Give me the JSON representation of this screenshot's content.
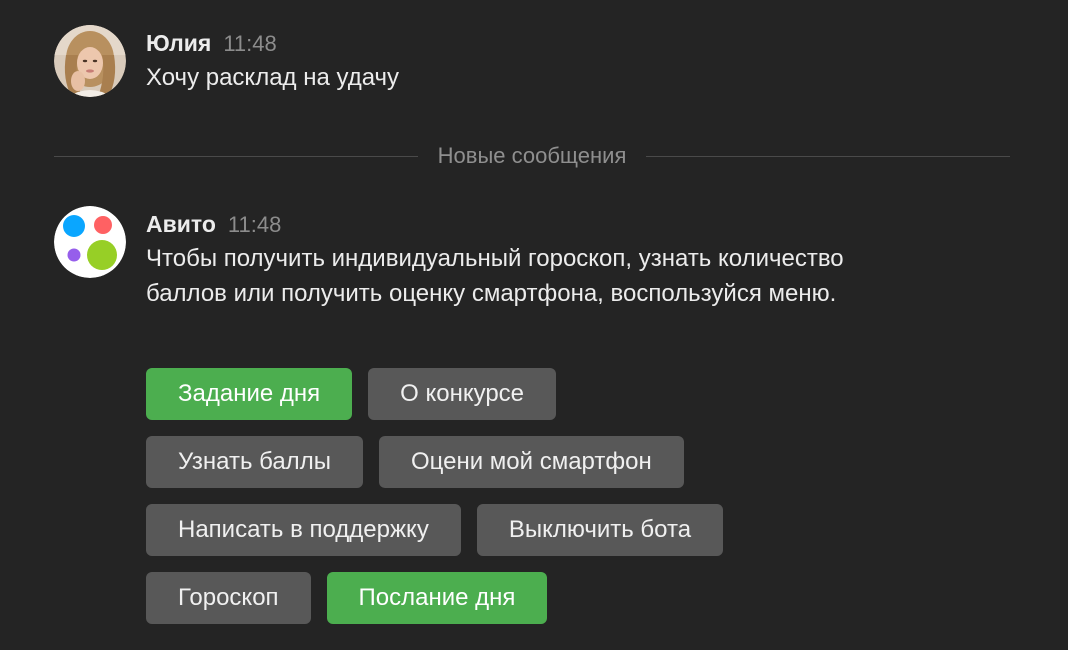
{
  "messages": [
    {
      "author": "Юлия",
      "time": "11:48",
      "text": "Хочу расклад на удачу",
      "avatar": "user-photo"
    },
    {
      "author": "Авито",
      "time": "11:48",
      "text": "Чтобы получить индивидуальный гороскоп, узнать количество баллов или получить оценку смартфона, воспользуйся меню.",
      "avatar": "avito-logo"
    }
  ],
  "divider": {
    "label": "Новые сообщения"
  },
  "menu": {
    "buttons": [
      {
        "label": "Задание дня",
        "variant": "green"
      },
      {
        "label": "О конкурсе",
        "variant": "gray"
      },
      {
        "label": "Узнать баллы",
        "variant": "gray"
      },
      {
        "label": "Оцени мой смартфон",
        "variant": "gray"
      },
      {
        "label": "Написать в поддержку",
        "variant": "gray"
      },
      {
        "label": "Выключить бота",
        "variant": "gray"
      },
      {
        "label": "Гороскоп",
        "variant": "gray"
      },
      {
        "label": "Послание дня",
        "variant": "green"
      }
    ]
  },
  "colors": {
    "background": "#242424",
    "button_green": "#4cae4f",
    "button_gray": "#585858",
    "avito_blue": "#0aa6ff",
    "avito_red": "#ff6163",
    "avito_purple": "#965eeb",
    "avito_green": "#97cf26"
  }
}
